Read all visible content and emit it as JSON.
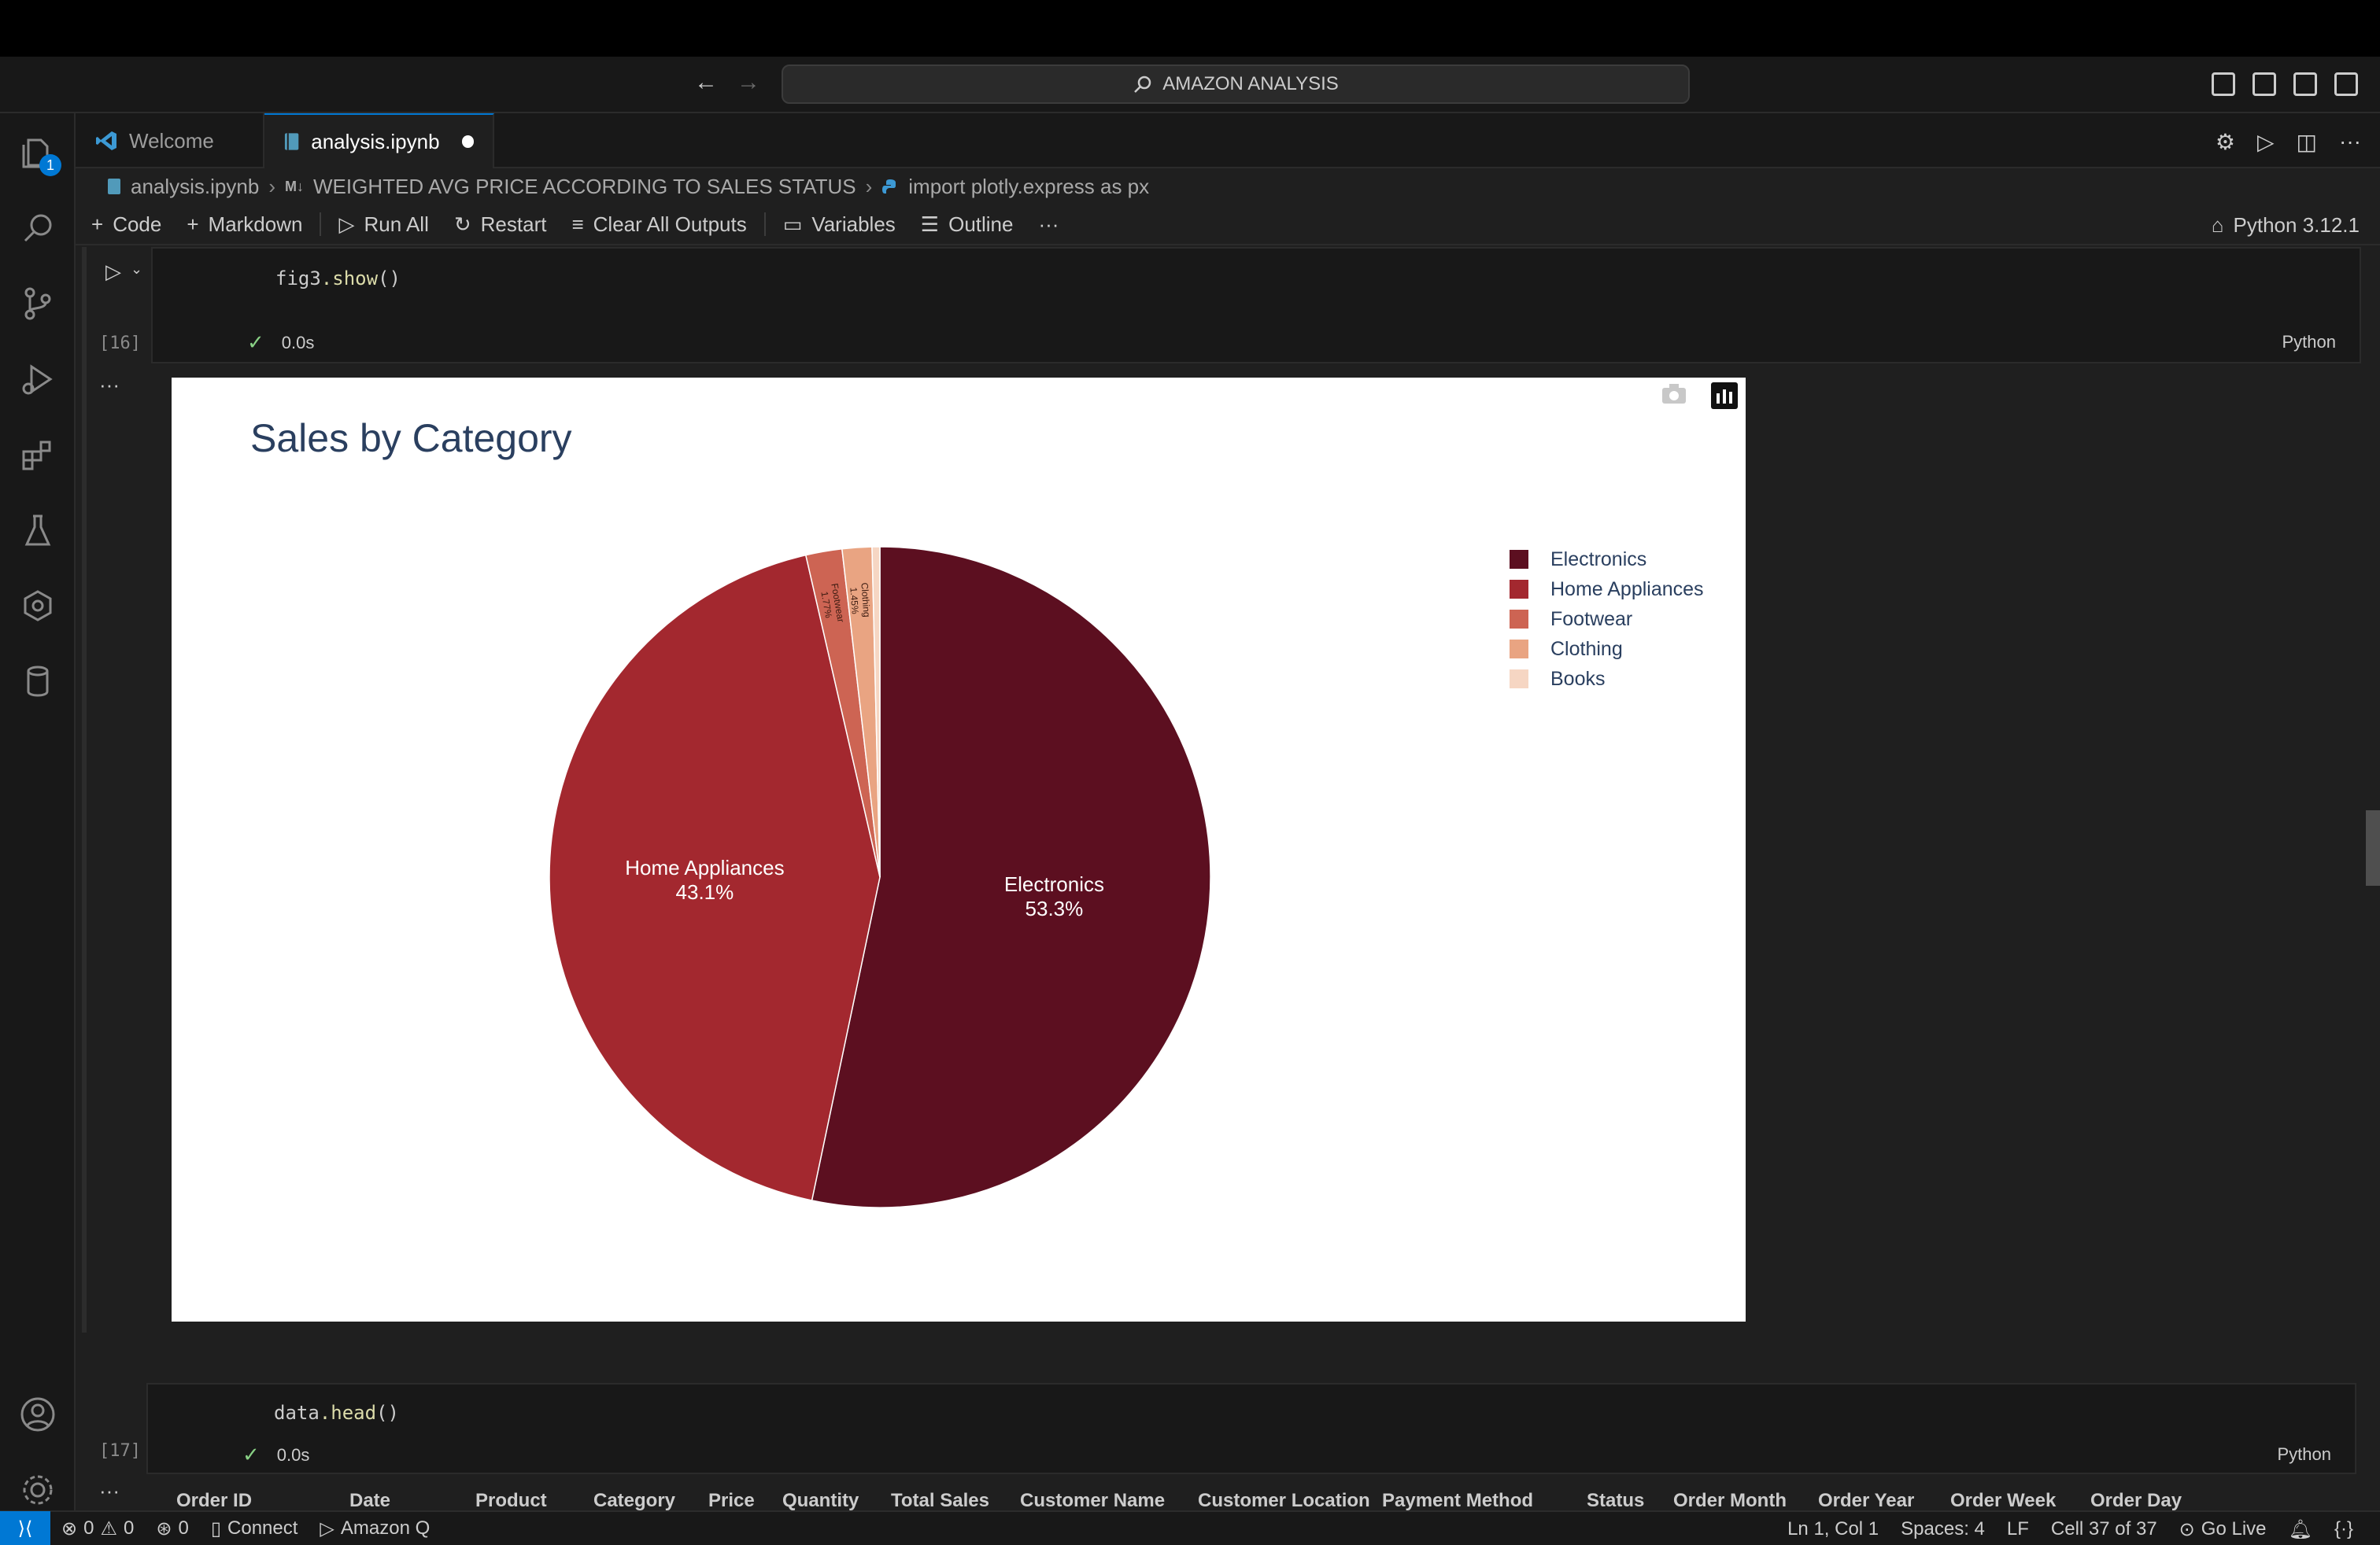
{
  "titlebar": {
    "search_text": "AMAZON ANALYSIS",
    "back_icon": "arrow-left-icon",
    "forward_icon": "arrow-right-icon"
  },
  "activity": {
    "explorer_badge": "1"
  },
  "tabs": [
    {
      "label": "Welcome",
      "icon": "vscode-logo-icon"
    },
    {
      "label": "analysis.ipynb",
      "icon": "notebook-icon"
    }
  ],
  "breadcrumb": {
    "file": "analysis.ipynb",
    "md_marker": "M↓",
    "section": "WEIGHTED AVG PRICE ACCORDING TO SALES STATUS",
    "cell": "import plotly.express as px"
  },
  "toolbar": {
    "code": "Code",
    "markdown": "Markdown",
    "run_all": "Run All",
    "restart": "Restart",
    "clear_outputs": "Clear All Outputs",
    "variables": "Variables",
    "outline": "Outline",
    "more": "···",
    "kernel": "Python 3.12.1"
  },
  "cells": {
    "cell16": {
      "code_obj": "fig3",
      "code_fn": ".show",
      "code_tail": "()",
      "count": "[16]",
      "time": "0.0s",
      "lang": "Python"
    },
    "output_ellipsis": "···",
    "cell17": {
      "code_obj": "data",
      "code_fn": ".head",
      "code_tail": "()",
      "count": "[17]",
      "time": "0.0s",
      "lang": "Python"
    }
  },
  "chart_data": {
    "type": "pie",
    "title": "Sales by Category",
    "labels": [
      "Electronics",
      "Home Appliances",
      "Footwear",
      "Clothing",
      "Books"
    ],
    "values": [
      53.3,
      43.1,
      1.77,
      1.45,
      0.38
    ],
    "colors": [
      "#5c0f20",
      "#a3282f",
      "#cd6453",
      "#e9a482",
      "#f6d6c3"
    ],
    "slice_labels": [
      {
        "name": "Electronics",
        "pct": "53.3%"
      },
      {
        "name": "Home Appliances",
        "pct": "43.1%"
      },
      {
        "name": "Footwear",
        "pct": "1.77%"
      },
      {
        "name": "Clothing",
        "pct": "1.45%"
      }
    ],
    "legend_position": "top-right"
  },
  "dataframe": {
    "columns": [
      "Order ID",
      "Date",
      "Product",
      "Category",
      "Price",
      "Quantity",
      "Total Sales",
      "Customer Name",
      "Customer Location",
      "Payment Method",
      "Status",
      "Order Month",
      "Order Year",
      "Order Week",
      "Order Day"
    ]
  },
  "statusbar": {
    "errors": "0",
    "warnings": "0",
    "ports": "0",
    "connect": "Connect",
    "amazon_q": "Amazon Q",
    "position": "Ln 1, Col 1",
    "spaces": "Spaces: 4",
    "eol": "LF",
    "cell": "Cell 37 of 37",
    "go_live": "Go Live"
  }
}
